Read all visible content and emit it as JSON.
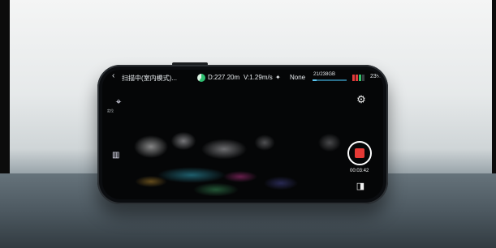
{
  "status_bar": {
    "back_glyph": "‹",
    "title": "扫描中(室内模式)...",
    "distance": "D:227.20m",
    "velocity": "V:1.29m/s",
    "satellite_icon": "satellite-icon",
    "gnss_status": "None",
    "storage": "21/238GB",
    "storage_used_fraction": 0.09,
    "battery_percent": "23%"
  },
  "controls": {
    "location_label": "定位",
    "settings_icon": "gear-icon",
    "record_time": "00:03:42",
    "colors": {
      "record": "#e53935",
      "battery_low": "#e23b3b",
      "battery_ok": "#32c06a",
      "storage": "#5cc6f0"
    }
  }
}
